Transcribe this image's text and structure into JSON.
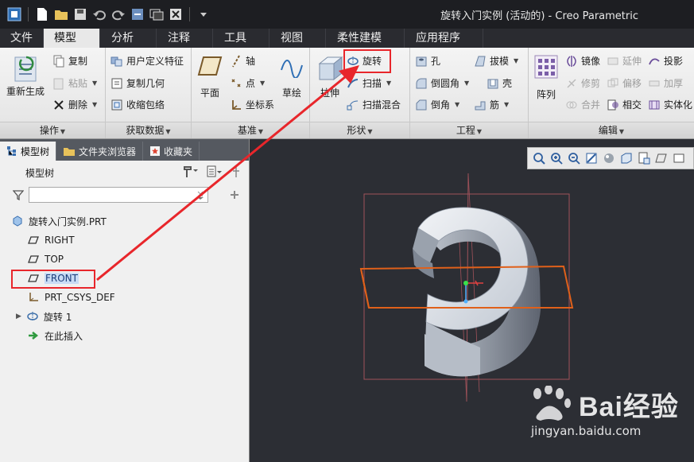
{
  "window": {
    "title": "旋转入门实例 (活动的) - Creo Parametric"
  },
  "menu_tabs": [
    "文件",
    "模型",
    "分析",
    "注释",
    "工具",
    "视图",
    "柔性建模",
    "应用程序"
  ],
  "active_tab": "模型",
  "ribbon": {
    "groups": {
      "operations": {
        "label": "操作",
        "regenerate": "重新生成",
        "copy": "复制",
        "paste": "粘贴",
        "delete": "删除"
      },
      "get_data": {
        "label": "获取数据",
        "udf": "用户定义特征",
        "copy_geometry": "复制几何",
        "shrinkwrap": "收缩包络"
      },
      "datum": {
        "label": "基准",
        "plane": "平面",
        "axis": "轴",
        "point": "点",
        "csys": "坐标系",
        "sketch": "草绘"
      },
      "shapes": {
        "label": "形状",
        "extrude": "拉伸",
        "revolve": "旋转",
        "sweep": "扫描",
        "swept_blend": "扫描混合"
      },
      "engineering": {
        "label": "工程",
        "hole": "孔",
        "draft": "拔模",
        "round": "倒圆角",
        "shell": "壳",
        "chamfer": "倒角",
        "rib": "筋"
      },
      "editing": {
        "label": "编辑",
        "pattern": "阵列",
        "mirror": "镜像",
        "extend": "延伸",
        "project": "投影",
        "trim": "修剪",
        "offset": "偏移",
        "thicken": "加厚",
        "merge": "合并",
        "intersect": "相交",
        "solidify": "实体化"
      }
    }
  },
  "left_panel": {
    "tabs": [
      "模型树",
      "文件夹浏览器",
      "收藏夹"
    ],
    "tree_title": "模型树",
    "filter_placeholder": "",
    "tree_items": [
      {
        "label": "旋转入门实例.PRT",
        "icon": "part-icon"
      },
      {
        "label": "RIGHT",
        "icon": "datum-plane-icon"
      },
      {
        "label": "TOP",
        "icon": "datum-plane-icon"
      },
      {
        "label": "FRONT",
        "icon": "datum-plane-icon",
        "selected": true
      },
      {
        "label": "PRT_CSYS_DEF",
        "icon": "csys-icon"
      },
      {
        "label": "旋转 1",
        "icon": "revolve-feature-icon",
        "expandable": true
      },
      {
        "label": "在此插入",
        "icon": "insert-here-arrow-icon"
      }
    ]
  },
  "watermark": {
    "brand_text": "Bai经验",
    "url": "jingyan.baidu.com"
  },
  "colors": {
    "highlight_red": "#e8262b",
    "datum_plane_orange": "#e0601a",
    "datum_plane_dim": "#a0525a",
    "part_light": "#d9dde3",
    "part_shadow": "#6c7280"
  }
}
